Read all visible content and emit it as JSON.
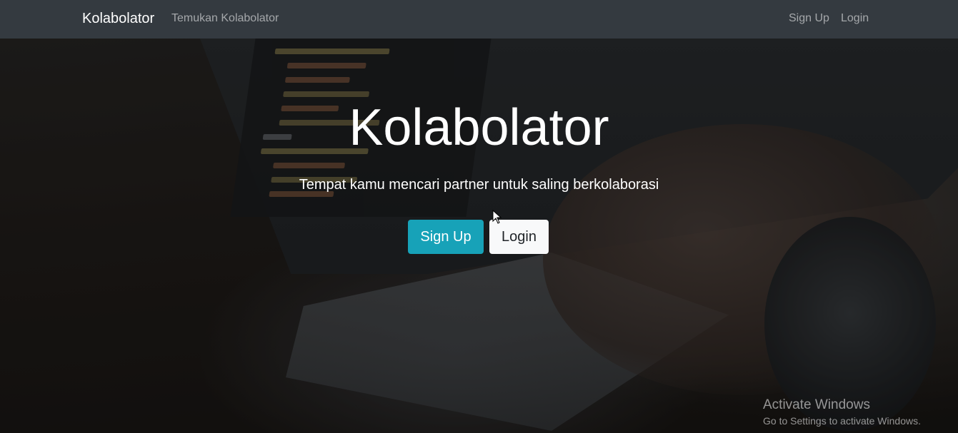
{
  "navbar": {
    "brand": "Kolabolator",
    "find_link": "Temukan Kolabolator",
    "signup_link": "Sign Up",
    "login_link": "Login"
  },
  "hero": {
    "title": "Kolabolator",
    "subtitle": "Tempat kamu mencari partner untuk saling berkolaborasi",
    "signup_button": "Sign Up",
    "login_button": "Login"
  },
  "watermark": {
    "title": "Activate Windows",
    "subtitle": "Go to Settings to activate Windows."
  },
  "colors": {
    "navbar_bg": "#343a40",
    "signup_button_bg": "#17a2b8",
    "login_button_bg": "#f8f9fa"
  }
}
